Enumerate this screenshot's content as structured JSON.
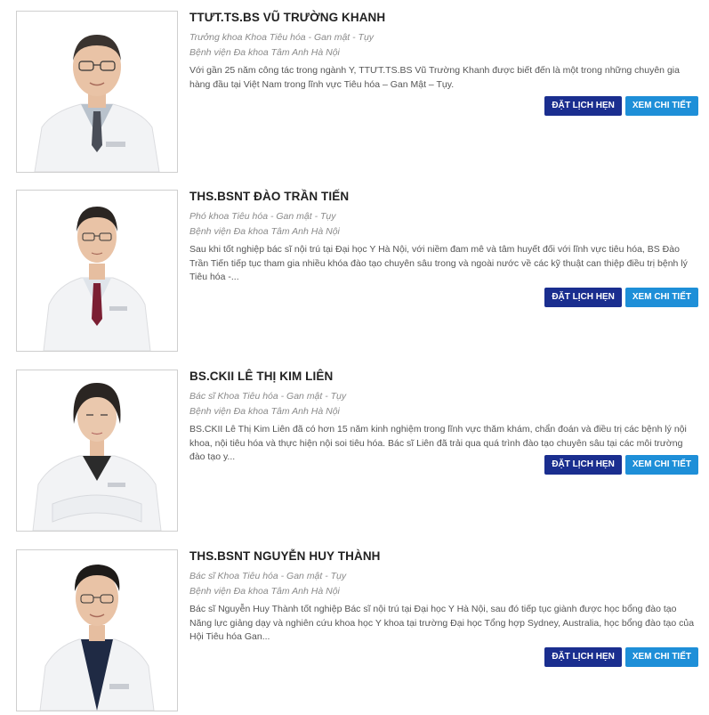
{
  "doctors": [
    {
      "name": "TTƯT.TS.BS VŨ TRƯỜNG KHANH",
      "role": "Trưởng khoa Khoa Tiêu hóa - Gan mật - Tụy",
      "hospital": "Bệnh viện Đa khoa Tâm Anh Hà Nội",
      "description": "Với gần 25 năm công tác trong ngành Y, TTƯT.TS.BS Vũ Trường Khanh được biết đến là một trong những chuyên gia hàng đầu tại Việt Nam trong lĩnh vực Tiêu hóa – Gan Mật – Tụy.",
      "book_label": "ĐẶT LỊCH HẸN",
      "detail_label": "XEM CHI TIẾT"
    },
    {
      "name": "THS.BSNT ĐÀO TRẦN TIẾN",
      "role": "Phó khoa Tiêu hóa - Gan mật - Tụy",
      "hospital": "Bệnh viện Đa khoa Tâm Anh Hà Nội",
      "description": "Sau khi tốt nghiệp bác sĩ nội trú tại Đại học Y Hà Nội, với niềm đam mê và tâm huyết đối với lĩnh vực tiêu hóa, BS Đào Trần Tiến tiếp tục tham gia nhiều khóa đào tạo chuyên sâu trong và ngoài nước về các kỹ thuật can thiệp điều trị bệnh lý Tiêu hóa -...",
      "book_label": "ĐẶT LỊCH HẸN",
      "detail_label": "XEM CHI TIẾT"
    },
    {
      "name": "BS.CKII LÊ THỊ KIM LIÊN",
      "role": "Bác sĩ Khoa Tiêu hóa - Gan mật - Tụy",
      "hospital": "Bệnh viện Đa khoa Tâm Anh Hà Nội",
      "description": "BS.CKII Lê Thị Kim Liên đã có hơn 15 năm kinh nghiệm trong lĩnh vực thăm khám, chẩn đoán và điều trị các bệnh lý nội khoa, nội tiêu hóa và thực hiện nội soi tiêu hóa. Bác sĩ Liên đã trải qua quá trình đào tạo chuyên sâu tại các môi trường đào tạo y...",
      "book_label": "ĐẶT LỊCH HẸN",
      "detail_label": "XEM CHI TIẾT"
    },
    {
      "name": "THS.BSNT NGUYỄN HUY THÀNH",
      "role": "Bác sĩ Khoa Tiêu hóa - Gan mật - Tụy",
      "hospital": "Bệnh viện Đa khoa Tâm Anh Hà Nội",
      "description": "Bác sĩ Nguyễn Huy Thành tốt nghiệp Bác sĩ nội trú tại Đại học Y Hà Nội, sau đó tiếp tục giành được học bổng đào tạo Năng lực giảng dạy và nghiên cứu khoa học Y khoa tại trường Đại học Tổng hợp Sydney, Australia, học bổng đào tạo của Hội Tiêu hóa Gan...",
      "book_label": "ĐẶT LỊCH HẸN",
      "detail_label": "XEM CHI TIẾT"
    }
  ],
  "colors": {
    "book_button": "#1a2e8f",
    "detail_button": "#1e8fd8",
    "coat": "#f4f5f7",
    "skin": "#e9c3a6",
    "hair": "#2a2522"
  }
}
